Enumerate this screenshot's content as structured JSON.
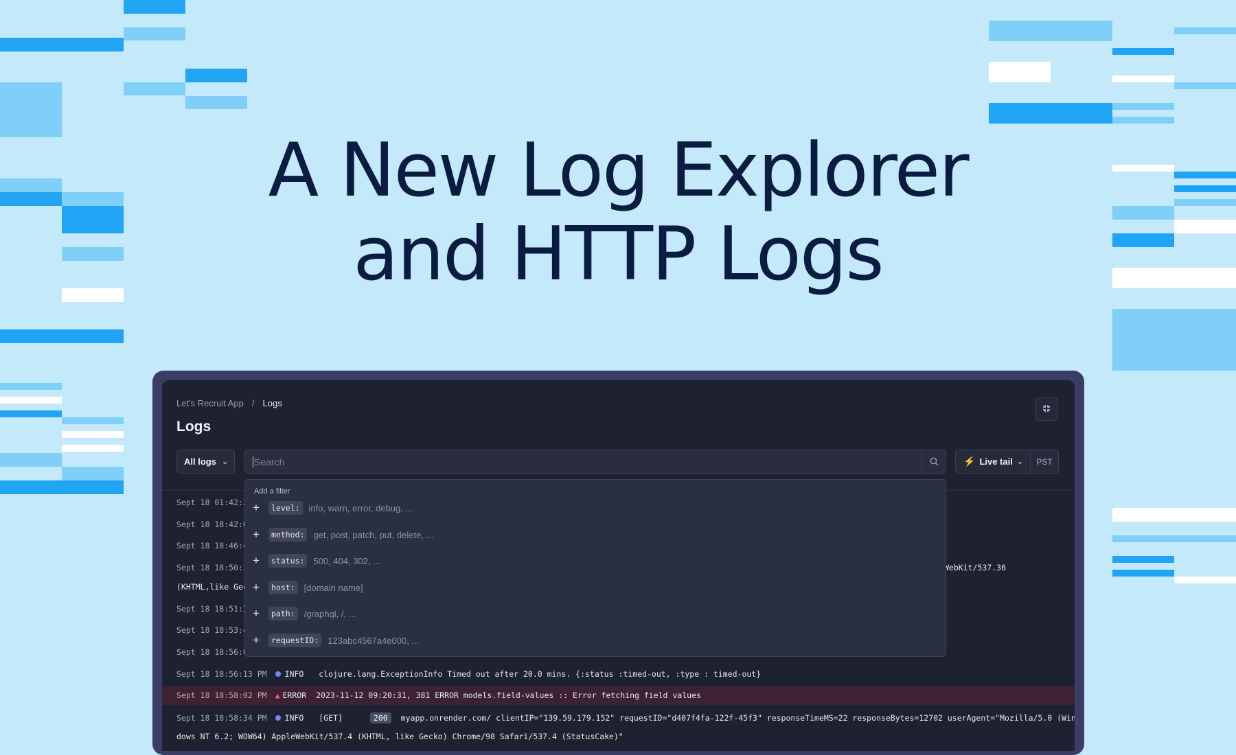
{
  "headline": {
    "line1": "A New Log Explorer",
    "line2": "and HTTP Logs"
  },
  "colors": {
    "background": "#c4e9fb",
    "deep_blue": "#22a4f5",
    "light_blue": "#7fcff8",
    "white": "#ffffff",
    "ink": "#0b1c43",
    "device": "#3b3d66",
    "screen": "#1e2130",
    "live_green": "#22c38e",
    "info_dot": "#6f86ff",
    "error_pink": "#ff5b7f"
  },
  "app": {
    "breadcrumb": {
      "app": "Let's Recruit App",
      "separator": "/",
      "current": "Logs"
    },
    "title": "Logs",
    "collapse_icon": "collapse-icon",
    "log_selector": "All logs",
    "search": {
      "placeholder": "Search",
      "icon": "search-icon"
    },
    "live_tail": {
      "label": "Live tail",
      "icon": "bolt-icon",
      "timezone": "PST"
    },
    "filter_menu": {
      "heading": "Add a filter",
      "items": [
        {
          "key": "level:",
          "hint": "info, warn, error, debug, ..."
        },
        {
          "key": "method:",
          "hint": "get, post, patch, put, delete, ..."
        },
        {
          "key": "status:",
          "hint": "500, 404, 302, ..."
        },
        {
          "key": "host:",
          "hint": "[domain name]"
        },
        {
          "key": "path:",
          "hint": "/graphql, /, ..."
        },
        {
          "key": "requestID:",
          "hint": "123abc4567a4e000, ..."
        }
      ]
    },
    "logs": {
      "partial": [
        "Sept 18 01:42:3",
        "Sept 18 18:42:0",
        "Sept 18 18:46:4",
        "Sept 18 18:50:1",
        "(KHTML,like Gec",
        "Sept 18 18:51:3",
        "Sept 18 18:53:4",
        "Sept 18 18:56:0"
      ],
      "partial_right": "WebKit/537.36",
      "info1": {
        "time": "Sept 18 18:56:13 PM",
        "level": "INFO",
        "message": "clojure.lang.ExceptionInfo Timed out after 20.0 mins. {:status :timed-out, :type : timed-out}"
      },
      "error1": {
        "time": "Sept 18 18:58:02 PM",
        "level": "ERROR",
        "message": "2023-11-12 09:20:31, 381 ERROR models.field-values :: Error fetching field values"
      },
      "info2": {
        "time": "Sept 18 18:58:34 PM",
        "level": "INFO",
        "method": "[GET]",
        "status": "200",
        "message": "myapp.onrender.com/ clientIP=\"139.59.179.152\" requestID=\"d407f4fa-122f-45f3\" responseTimeMS=22 responseBytes=12702 userAgent=\"Mozilla/5.0 (Win",
        "continuation": "dows NT 6.2; WOW64) AppleWebKit/537.4 (KHTML, like Gecko) Chrome/98 Safari/537.4 (StatusCake)\""
      }
    }
  }
}
